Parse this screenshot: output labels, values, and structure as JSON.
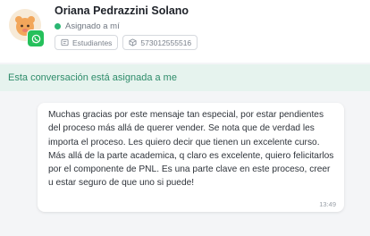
{
  "contact": {
    "name": "Oriana Pedrazzini Solano",
    "status": "Asignado a mí",
    "tags": [
      {
        "label": "Estudiantes",
        "icon": "tag-icon"
      },
      {
        "label": "573012555516",
        "icon": "phone-icon"
      }
    ],
    "channel_icon": "whatsapp-icon"
  },
  "banner": {
    "text": "Esta conversación está asignada a me"
  },
  "message": {
    "text": "Muchas gracias por este mensaje tan especial, por estar pendientes del proceso más allá de querer vender. Se nota que de verdad les importa el proceso. Les quiero decir que tienen un excelente curso. Más allá de la parte academica, q claro es excelente, quiero felicitarlos por el componente de PNL. Es una parte clave en este proceso, creer u estar seguro de que uno si puede!",
    "time": "13:49"
  },
  "colors": {
    "accent_green": "#2bb673",
    "banner_bg": "#e6f3ee",
    "banner_text": "#2e8c6a",
    "whatsapp": "#25c05b"
  }
}
